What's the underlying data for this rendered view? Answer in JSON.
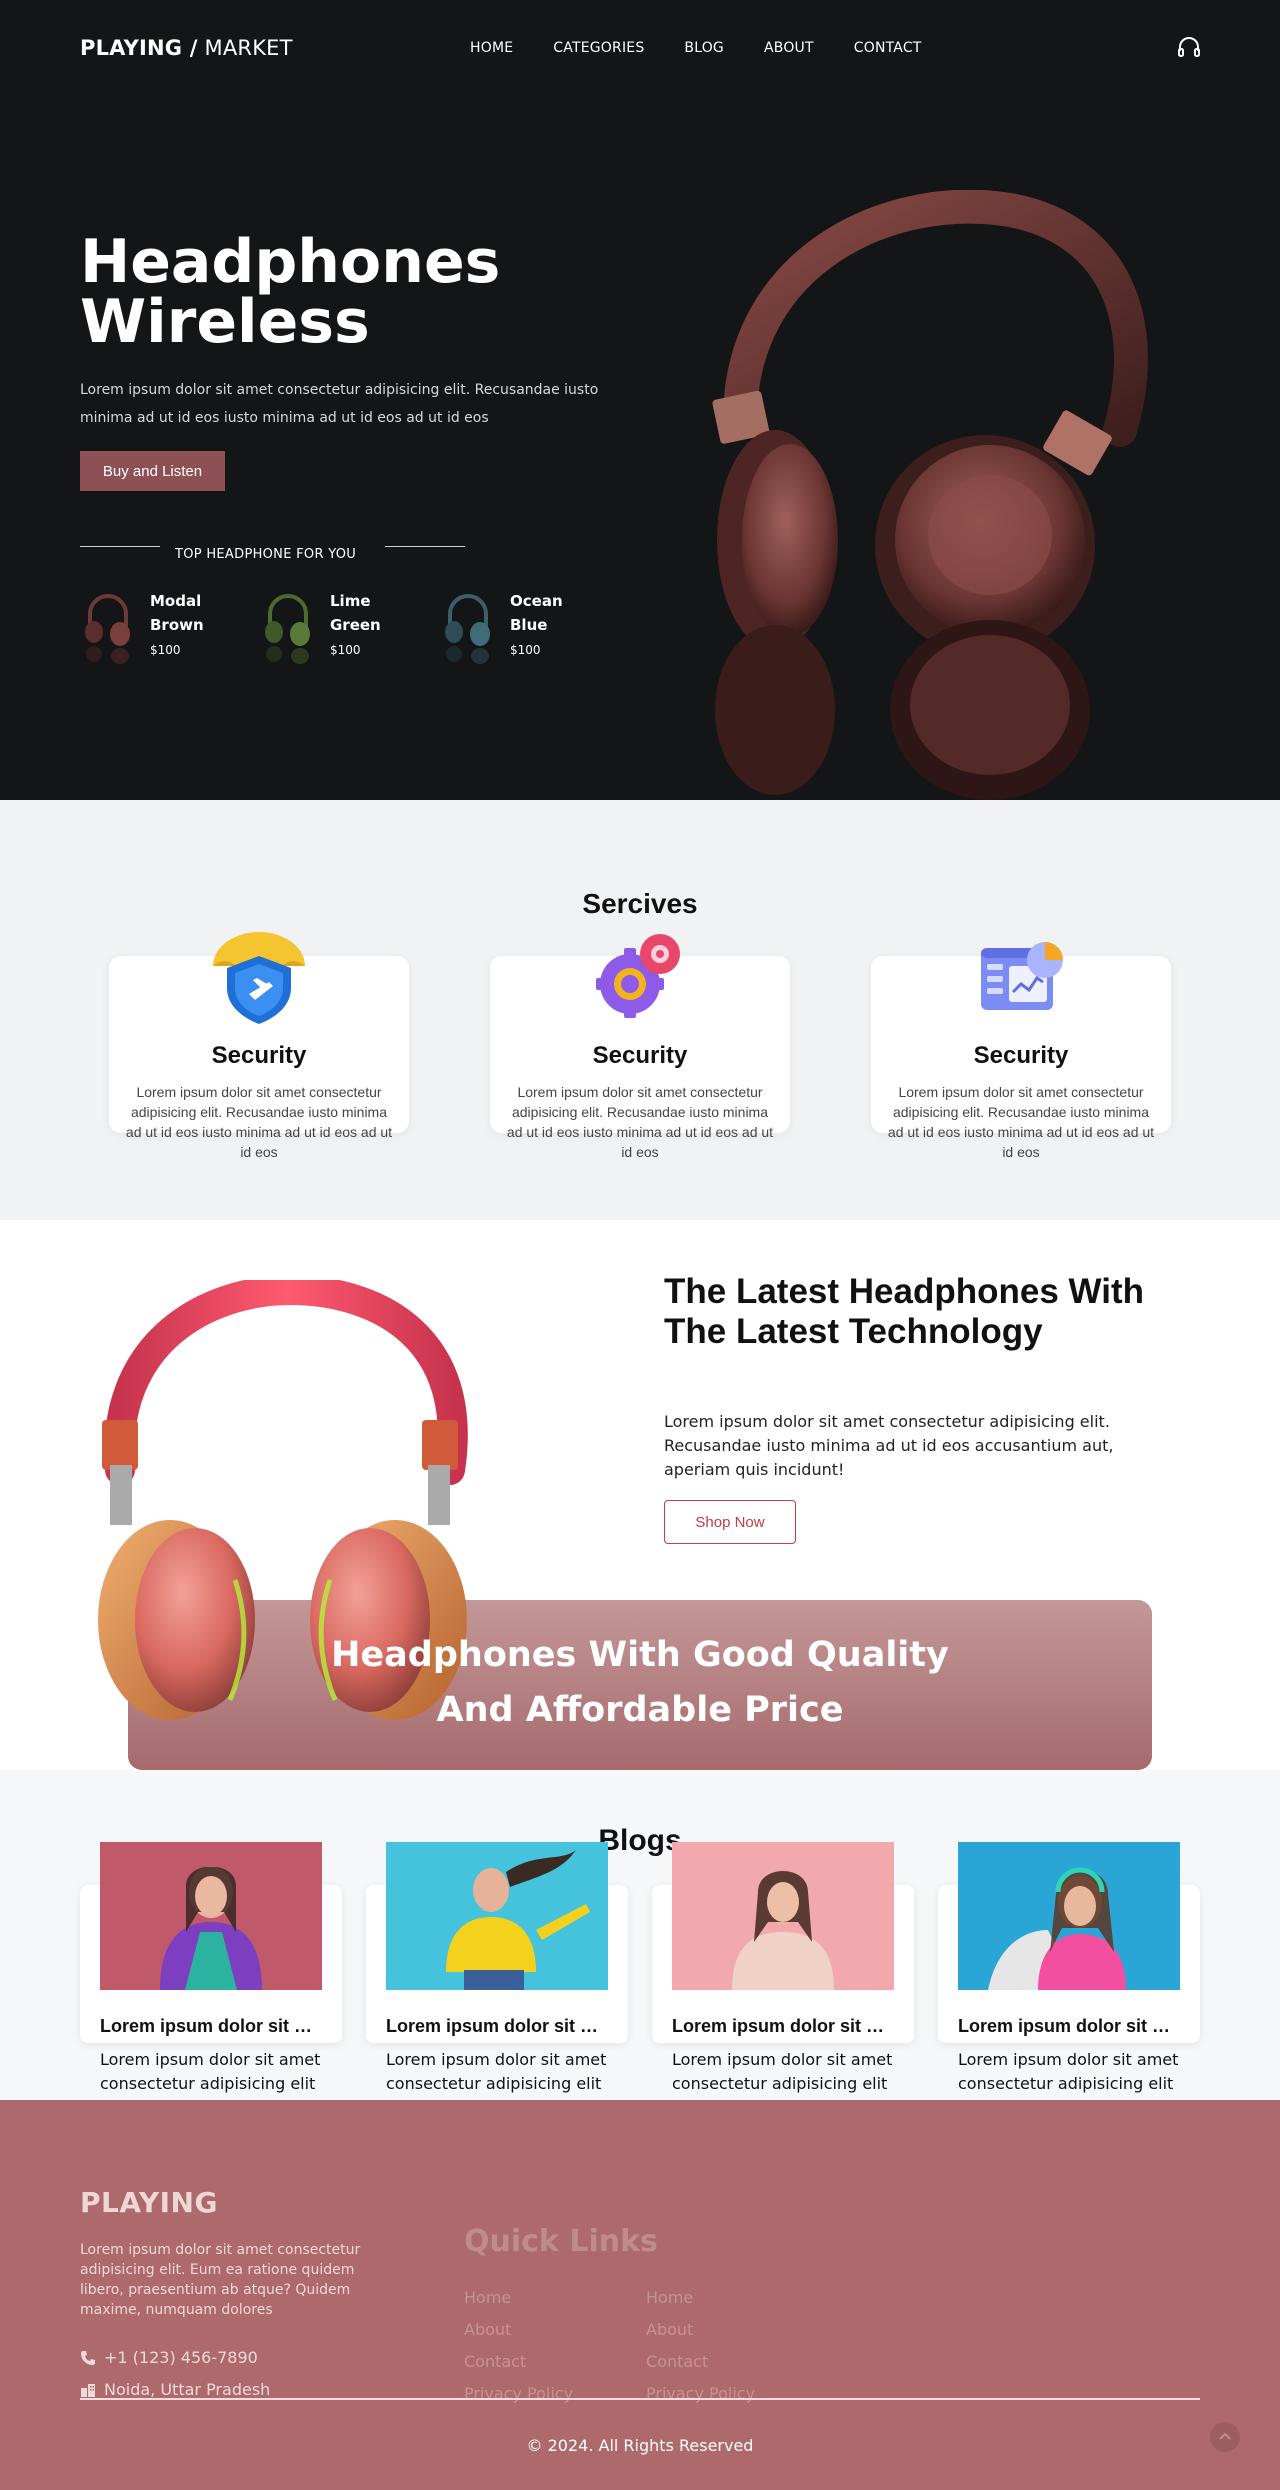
{
  "header": {
    "logo_bold": "PLAYING /",
    "logo_thin": " MARKET",
    "nav": [
      "HOME",
      "CATEGORIES",
      "BLOG",
      "ABOUT",
      "CONTACT"
    ],
    "icon": "headphones-icon"
  },
  "hero": {
    "title_line1": "Headphones",
    "title_line2": "Wireless",
    "description": "Lorem ipsum dolor sit amet consectetur adipisicing elit. Recusandae iusto minima ad ut id eos iusto minima ad ut id eos ad ut id eos",
    "button_label": "Buy and Listen",
    "top_label": "TOP HEADPHONE FOR YOU",
    "products": [
      {
        "name": "Modal Brown",
        "price": "$100",
        "color": "#7a3f3c"
      },
      {
        "name": "Lime Green",
        "price": "$100",
        "color": "#5a7a3a"
      },
      {
        "name": "Ocean Blue",
        "price": "$100",
        "color": "#3f6c78"
      }
    ]
  },
  "services": {
    "title": "Sercives",
    "items": [
      {
        "name": "Security",
        "text": "Lorem ipsum dolor sit amet consectetur adipisicing elit. Recusandae iusto minima ad ut id eos iusto minima ad ut id eos ad ut id eos",
        "icon": "umbrella-shield-icon"
      },
      {
        "name": "Security",
        "text": "Lorem ipsum dolor sit amet consectetur adipisicing elit. Recusandae iusto minima ad ut id eos iusto minima ad ut id eos ad ut id eos",
        "icon": "gears-icon"
      },
      {
        "name": "Security",
        "text": "Lorem ipsum dolor sit amet consectetur adipisicing elit. Recusandae iusto minima ad ut id eos iusto minima ad ut id eos ad ut id eos",
        "icon": "dashboard-chart-icon"
      }
    ]
  },
  "latest": {
    "title": "The Latest Headphones With The Latest Technology",
    "description": "Lorem ipsum dolor sit amet consectetur adipisicing elit. Recusandae iusto minima ad ut id eos accusantium aut, aperiam quis incidunt!",
    "button_label": "Shop Now",
    "banner_text": "Headphones With Good Quality And Affordable Price"
  },
  "blogs": {
    "title": "Blogs",
    "items": [
      {
        "heading": "Lorem ipsum dolor sit amet",
        "text": "Lorem ipsum dolor sit amet consectetur adipisicing elit",
        "bg": "#c0596a"
      },
      {
        "heading": "Lorem ipsum dolor sit amet",
        "text": "Lorem ipsum dolor sit amet consectetur adipisicing elit",
        "bg": "#45c3dd"
      },
      {
        "heading": "Lorem ipsum dolor sit amet",
        "text": "Lorem ipsum dolor sit amet consectetur adipisicing elit",
        "bg": "#f2a9ad"
      },
      {
        "heading": "Lorem ipsum dolor sit amet",
        "text": "Lorem ipsum dolor sit amet consectetur adipisicing elit",
        "bg": "#2aa6d6"
      }
    ]
  },
  "footer": {
    "logo": "PLAYING",
    "description": "Lorem ipsum dolor sit amet consectetur adipisicing elit. Eum ea ratione quidem libero, praesentium ab atque? Quidem maxime, numquam dolores",
    "phone": "+1 (123) 456-7890",
    "address": "Noida, Uttar Pradesh",
    "quick_links_title": "Quick Links",
    "links_col1": [
      "Home",
      "About",
      "Contact",
      "Privacy Policy"
    ],
    "links_col2": [
      "Home",
      "About",
      "Contact",
      "Privacy Policy"
    ],
    "copyright": "© 2024. All Rights Reserved"
  },
  "colors": {
    "hero_bg": "#141516",
    "accent": "#8d5155",
    "footer_bg": "#ad696b",
    "cta_red": "#c43b42"
  }
}
